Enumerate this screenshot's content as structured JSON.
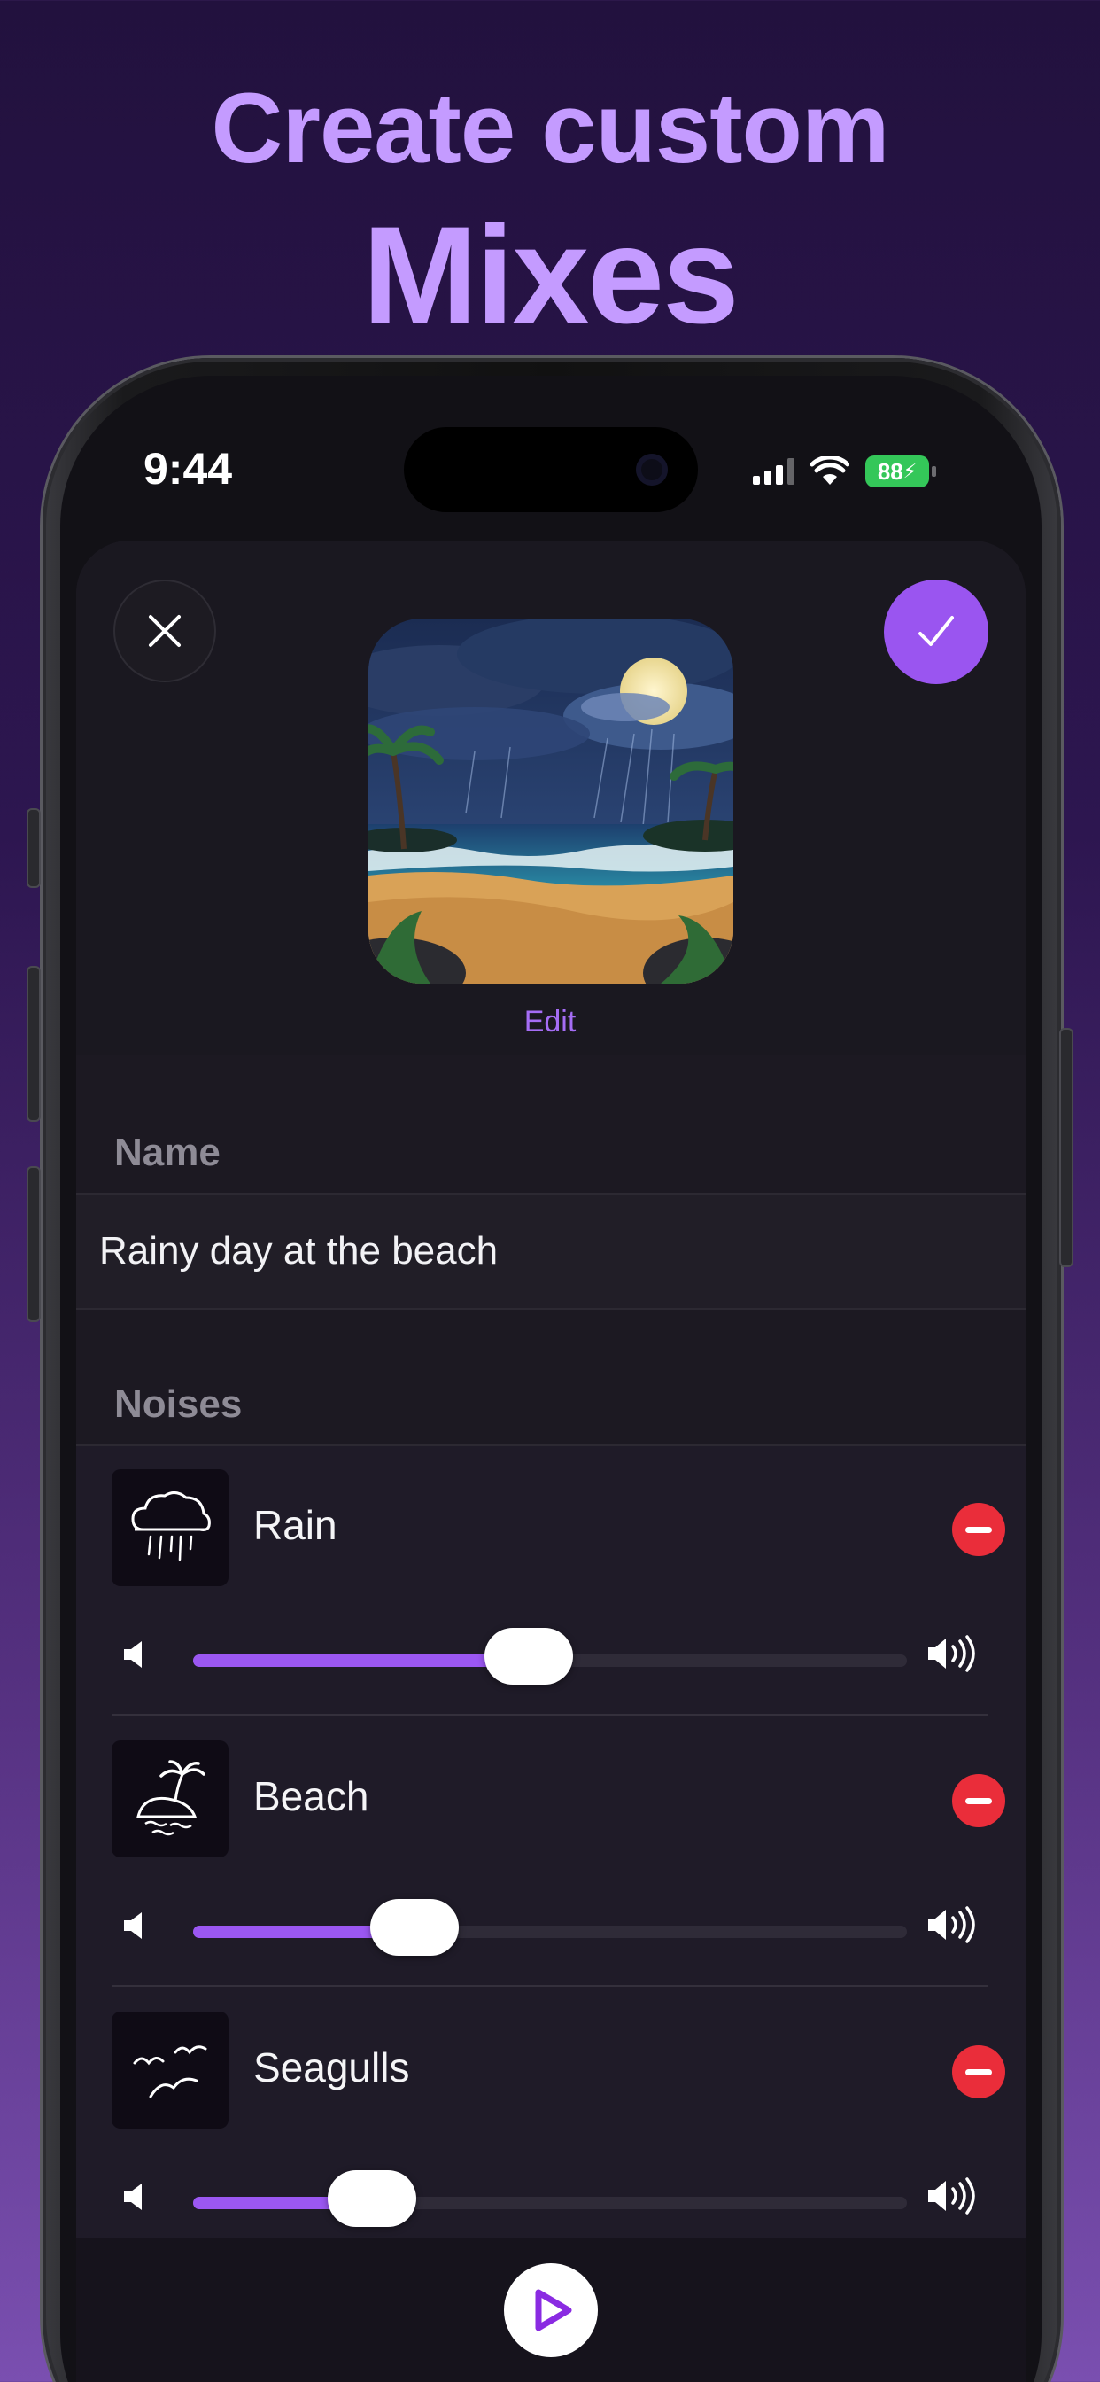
{
  "headline": {
    "line1": "Create custom",
    "line2": "Mixes"
  },
  "status_bar": {
    "time": "9:44",
    "battery": "88"
  },
  "header": {
    "edit_label": "Edit",
    "artwork_description": "beach-night-rain-artwork"
  },
  "name_section": {
    "label": "Name",
    "value": "Rainy day at the beach"
  },
  "noises_section": {
    "label": "Noises",
    "items": [
      {
        "title": "Rain",
        "icon": "rain-cloud-icon",
        "volume": 0.47
      },
      {
        "title": "Beach",
        "icon": "island-palm-icon",
        "volume": 0.31
      },
      {
        "title": "Seagulls",
        "icon": "seagulls-icon",
        "volume": 0.25
      }
    ]
  },
  "colors": {
    "accent": "#9b57f2",
    "remove": "#ea2d3a",
    "headline": "#c49bff"
  }
}
